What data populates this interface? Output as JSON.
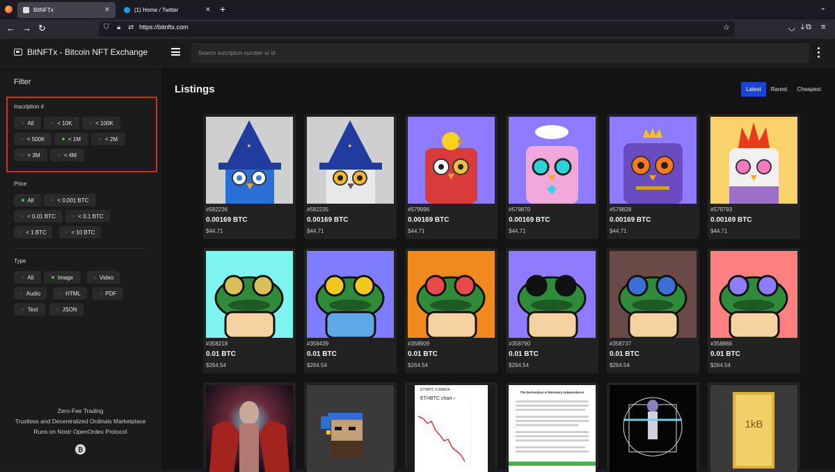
{
  "browser": {
    "tabs": [
      {
        "title": "BitNFTx",
        "active": true
      },
      {
        "title": "(1) Home / Twitter",
        "active": false
      }
    ],
    "url": "https://bitnftx.com"
  },
  "app": {
    "brand": "BitNFTx - Bitcoin NFT Exchange",
    "search_placeholder": "Search inscription number or id"
  },
  "sidebar": {
    "title": "Filter",
    "inscription": {
      "label": "Inscription #",
      "options": [
        {
          "label": "All",
          "selected": false
        },
        {
          "label": "< 10K",
          "selected": false
        },
        {
          "label": "< 100K",
          "selected": false
        },
        {
          "label": "< 500K",
          "selected": false
        },
        {
          "label": "< 1M",
          "selected": true
        },
        {
          "label": "< 2M",
          "selected": false
        },
        {
          "label": "< 3M",
          "selected": false
        },
        {
          "label": "< 4M",
          "selected": false
        }
      ]
    },
    "price": {
      "label": "Price",
      "options": [
        {
          "label": "All",
          "selected": true
        },
        {
          "label": "< 0.001 BTC",
          "selected": false
        },
        {
          "label": "< 0.01 BTC",
          "selected": false
        },
        {
          "label": "< 0.1 BTC",
          "selected": false
        },
        {
          "label": "< 1 BTC",
          "selected": false
        },
        {
          "label": "< 10 BTC",
          "selected": false
        }
      ]
    },
    "type": {
      "label": "Type",
      "options": [
        {
          "label": "All",
          "selected": false
        },
        {
          "label": "Image",
          "selected": true
        },
        {
          "label": "Video",
          "selected": false
        },
        {
          "label": "Audio",
          "selected": false
        },
        {
          "label": "HTML",
          "selected": false
        },
        {
          "label": "PDF",
          "selected": false
        },
        {
          "label": "Text",
          "selected": false
        },
        {
          "label": "JSON",
          "selected": false
        }
      ]
    },
    "footer": [
      "Zero-Fee Trading",
      "Trustless and Decentralized Ordinals Marketplace",
      "Runs on Nostr OpenOrdex Protocol"
    ],
    "footer_badge": "₿"
  },
  "main": {
    "title": "Listings",
    "sort": [
      {
        "label": "Latest",
        "active": true
      },
      {
        "label": "Rarest",
        "active": false
      },
      {
        "label": "Cheapest",
        "active": false
      }
    ],
    "listings": [
      {
        "number": "#582236",
        "price": "0.00169 BTC",
        "usd": "$44.71",
        "art": "wizard-owl-blue"
      },
      {
        "number": "#582235",
        "price": "0.00169 BTC",
        "usd": "$44.71",
        "art": "wizard-owl-white"
      },
      {
        "number": "#579996",
        "price": "0.00169 BTC",
        "usd": "$44.71",
        "art": "owl-red-duck"
      },
      {
        "number": "#579870",
        "price": "0.00169 BTC",
        "usd": "$44.71",
        "art": "owl-pink-cloud"
      },
      {
        "number": "#579828",
        "price": "0.00169 BTC",
        "usd": "$44.71",
        "art": "owl-purple-crown"
      },
      {
        "number": "#579793",
        "price": "0.00169 BTC",
        "usd": "$44.71",
        "art": "owl-white-fire"
      },
      {
        "number": "#358218",
        "price": "0.01 BTC",
        "usd": "$264.54",
        "art": "frog-cyan"
      },
      {
        "number": "#358439",
        "price": "0.01 BTC",
        "usd": "$264.54",
        "art": "frog-blue"
      },
      {
        "number": "#358909",
        "price": "0.01 BTC",
        "usd": "$264.54",
        "art": "frog-orange"
      },
      {
        "number": "#358790",
        "price": "0.01 BTC",
        "usd": "$264.54",
        "art": "frog-violet"
      },
      {
        "number": "#358737",
        "price": "0.01 BTC",
        "usd": "$264.54",
        "art": "frog-brown"
      },
      {
        "number": "#358866",
        "price": "0.01 BTC",
        "usd": "$264.54",
        "art": "frog-pink"
      },
      {
        "number": "",
        "price": "",
        "usd": "",
        "art": "demon-woman"
      },
      {
        "number": "",
        "price": "",
        "usd": "",
        "art": "pixel-pirate"
      },
      {
        "number": "",
        "price": "",
        "usd": "",
        "art": "ethbtc-chart",
        "chart_title": "ETHBTC chart ›",
        "chart_header": "ETHBTC  0.068424"
      },
      {
        "number": "",
        "price": "",
        "usd": "",
        "art": "declaration-doc",
        "doc_title": "The Declaration of Monetary Independence"
      },
      {
        "number": "",
        "price": "",
        "usd": "",
        "art": "vitruvian-figure"
      },
      {
        "number": "",
        "price": "",
        "usd": "",
        "art": "gold-bar",
        "bar_text": "1kB"
      }
    ]
  },
  "colors": {
    "accent": "#1a43d8",
    "highlight_border": "#d0301c",
    "selected_dot": "#33cc33"
  }
}
